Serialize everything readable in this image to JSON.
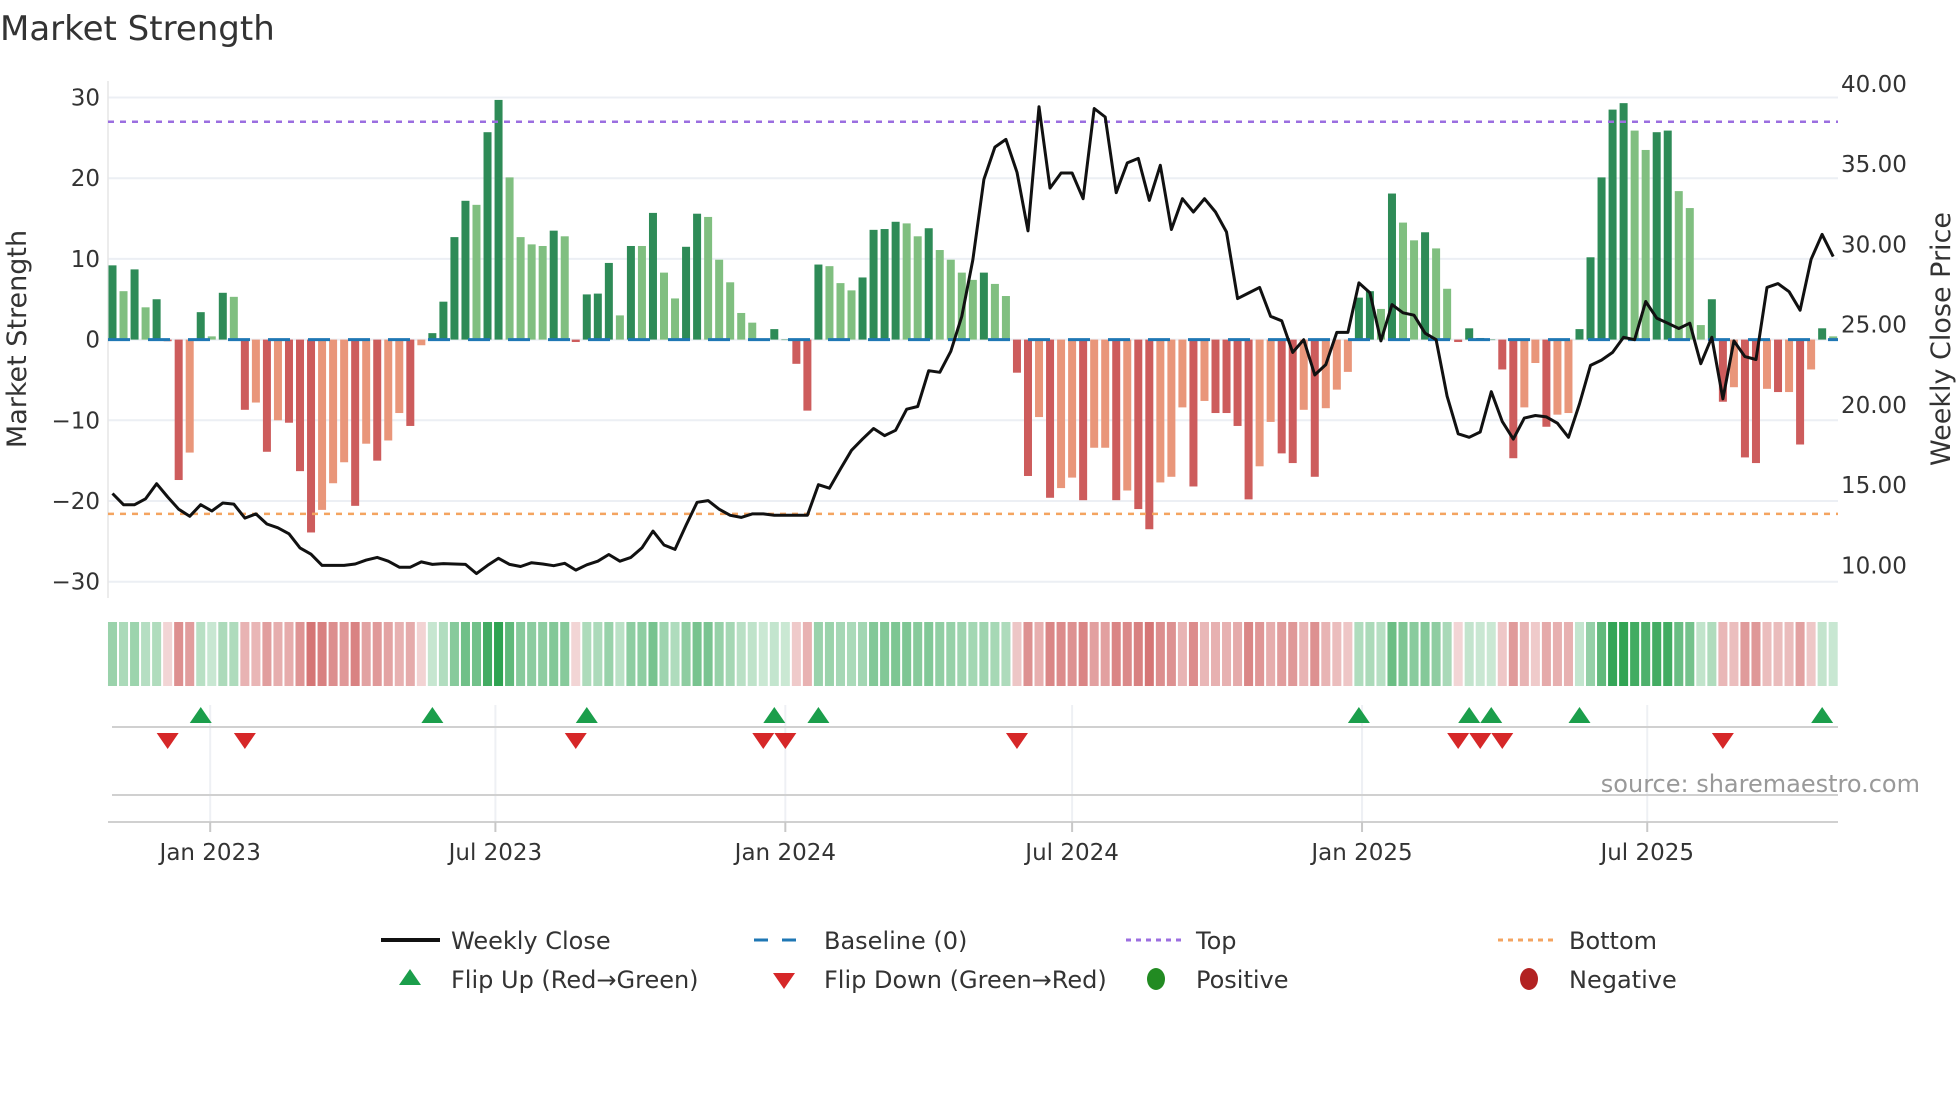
{
  "title": "Market Strength",
  "source": "source: sharemaestro.com",
  "colors": {
    "bar_pos_dark": "#2e8b57",
    "bar_pos_light": "#80bf80",
    "bar_neg_dark": "#cd5c5c",
    "bar_neg_light": "#e9967a",
    "baseline": "#1f77b4",
    "top": "#9b6ee0",
    "bottom": "#f4a460",
    "flip_up": "#1b9e4b",
    "flip_down": "#d62728",
    "positive": "#228b22",
    "negative": "#b22222",
    "price": "#111111"
  },
  "legend": {
    "weekly_close": "Weekly Close",
    "baseline": "Baseline (0)",
    "top": "Top",
    "bottom": "Bottom",
    "flip_up": "Flip Up (Red→Green)",
    "flip_down": "Flip Down (Green→Red)",
    "positive": "Positive",
    "negative": "Negative"
  },
  "chart_data": {
    "type": "bar",
    "title": "Market Strength",
    "ylabel": "Market Strength",
    "y2label": "Weekly Close Price",
    "ylim": [
      -32,
      32
    ],
    "y2lim": [
      8.9,
      41.0
    ],
    "yticks": [
      "30",
      "20",
      "10",
      "0",
      "−10",
      "−20",
      "−30"
    ],
    "ytick_values": [
      30,
      20,
      10,
      0,
      -10,
      -20,
      -30
    ],
    "y2ticks": [
      "40.00",
      "35.00",
      "30.00",
      "25.00",
      "20.00",
      "15.00",
      "10.00"
    ],
    "y2tick_values": [
      40,
      35,
      30,
      25,
      20,
      15,
      10
    ],
    "first_week": "2022-10-31",
    "xticks": [
      {
        "label": "Jan 2023",
        "date": "2023-01-01"
      },
      {
        "label": "Jul 2023",
        "date": "2023-07-01"
      },
      {
        "label": "Jan 2024",
        "date": "2024-01-01"
      },
      {
        "label": "Jul 2024",
        "date": "2024-07-01"
      },
      {
        "label": "Jan 2025",
        "date": "2025-01-01"
      },
      {
        "label": "Jul 2025",
        "date": "2025-07-01"
      }
    ],
    "top_level": 27,
    "bottom_level": -21.6,
    "baseline_level": 0,
    "strength": [
      9.2,
      6.0,
      8.7,
      4.0,
      5.0,
      -0.2,
      -17.4,
      -14.0,
      3.4,
      0.4,
      5.8,
      5.3,
      -8.7,
      -7.8,
      -13.9,
      -10.0,
      -10.3,
      -16.3,
      -23.9,
      -21.1,
      -17.8,
      -15.2,
      -20.6,
      -12.9,
      -15.0,
      -12.5,
      -9.1,
      -10.7,
      -0.7,
      0.8,
      4.7,
      12.7,
      17.2,
      16.7,
      25.7,
      29.7,
      20.1,
      12.7,
      11.8,
      11.6,
      13.5,
      12.8,
      -0.3,
      5.6,
      5.7,
      9.5,
      3.0,
      11.6,
      11.6,
      15.7,
      8.3,
      5.1,
      11.5,
      15.6,
      15.2,
      9.9,
      7.1,
      3.3,
      2.1,
      0,
      1.3,
      0,
      -3.0,
      -8.8,
      9.3,
      9.1,
      7.0,
      6.1,
      7.7,
      13.6,
      13.7,
      14.6,
      14.4,
      12.8,
      13.8,
      11.1,
      9.9,
      8.3,
      7.4,
      8.3,
      6.9,
      5.4,
      -4.1,
      -16.9,
      -9.6,
      -19.6,
      -18.4,
      -17.1,
      -19.9,
      -13.4,
      -13.4,
      -19.9,
      -18.7,
      -21.0,
      -23.5,
      -17.7,
      -17.0,
      -8.4,
      -18.2,
      -7.6,
      -9.1,
      -9.1,
      -10.7,
      -19.8,
      -15.7,
      -10.2,
      -14.1,
      -15.3,
      -8.7,
      -17.0,
      -8.5,
      -6.2,
      -4.0,
      5.2,
      6.0,
      3.8,
      18.1,
      14.5,
      12.3,
      13.3,
      11.3,
      6.3,
      -0.3,
      1.4,
      0.2,
      0,
      -3.7,
      -14.7,
      -8.4,
      -2.9,
      -10.8,
      -9.3,
      -9.1,
      1.3,
      10.2,
      20.1,
      28.5,
      29.3,
      25.9,
      23.5,
      25.7,
      25.9,
      18.4,
      16.3,
      1.8,
      5.0,
      -7.7,
      -5.9,
      -14.6,
      -15.3,
      -6.1,
      -6.5,
      -6.5,
      -13.0,
      -3.7,
      1.4,
      0.4
    ],
    "shade": "DLDLDDDLDLDLDLDLDDDLLLDLDLLDLDDDDLDDLLLLDLDDDDLDLDLLDDLLLLLLDDDDDLLLDDDDLLDLLLLDLLDDLDLLDLLDLDDLLLDLDDDDLLDDLDLLLDDLDLLDLLDDDDDDLLDLLDDDDDLLDDLLLDDLDDLDLDLDL",
    "weekly_close": [
      14.48,
      13.78,
      13.78,
      14.15,
      15.09,
      14.26,
      13.5,
      13.06,
      13.78,
      13.39,
      13.89,
      13.82,
      12.95,
      13.21,
      12.58,
      12.34,
      11.97,
      11.09,
      10.7,
      10.0,
      10.0,
      10.0,
      10.09,
      10.33,
      10.5,
      10.26,
      9.89,
      9.89,
      10.22,
      10.06,
      10.11,
      10.09,
      10.06,
      9.49,
      10.0,
      10.44,
      10.06,
      9.93,
      10.17,
      10.09,
      9.98,
      10.13,
      9.71,
      10.04,
      10.26,
      10.68,
      10.26,
      10.5,
      11.09,
      12.14,
      11.27,
      11.0,
      12.51,
      13.93,
      14.04,
      13.5,
      13.12,
      12.99,
      13.21,
      13.21,
      13.12,
      13.12,
      13.12,
      13.12,
      15.03,
      14.81,
      16.01,
      17.17,
      17.87,
      18.53,
      18.09,
      18.42,
      19.73,
      19.9,
      22.13,
      22.03,
      23.34,
      25.52,
      29.02,
      34.05,
      36.06,
      36.54,
      34.49,
      30.84,
      38.58,
      33.51,
      34.45,
      34.45,
      32.85,
      38.47,
      37.94,
      33.22,
      35.08,
      35.36,
      32.74,
      34.93,
      30.93,
      32.85,
      32.02,
      32.85,
      32.02,
      30.77,
      26.62,
      26.97,
      27.32,
      25.52,
      25.24,
      23.27,
      24.06,
      21.87,
      22.51,
      24.52,
      24.52,
      27.6,
      26.99,
      23.99,
      26.25,
      25.74,
      25.59,
      24.47,
      24.06,
      20.54,
      18.2,
      17.98,
      18.31,
      20.82,
      18.96,
      17.87,
      19.18,
      19.34,
      19.25,
      18.86,
      17.98,
      20.06,
      22.46,
      22.79,
      23.27,
      24.21,
      24.06,
      26.44,
      25.41,
      25.09,
      24.76,
      25.09,
      22.57,
      24.21,
      20.38,
      23.99,
      23.01,
      22.83,
      27.32,
      27.56,
      27.05,
      25.9,
      29.07,
      30.62,
      29.24
    ],
    "flip_up_weeks": [
      8,
      29,
      43,
      60,
      64,
      113,
      123,
      125,
      133,
      155
    ],
    "flip_down_weeks": [
      5,
      12,
      42,
      59,
      61,
      82,
      122,
      124,
      126,
      146
    ],
    "legend_placement": "bottom-center"
  }
}
